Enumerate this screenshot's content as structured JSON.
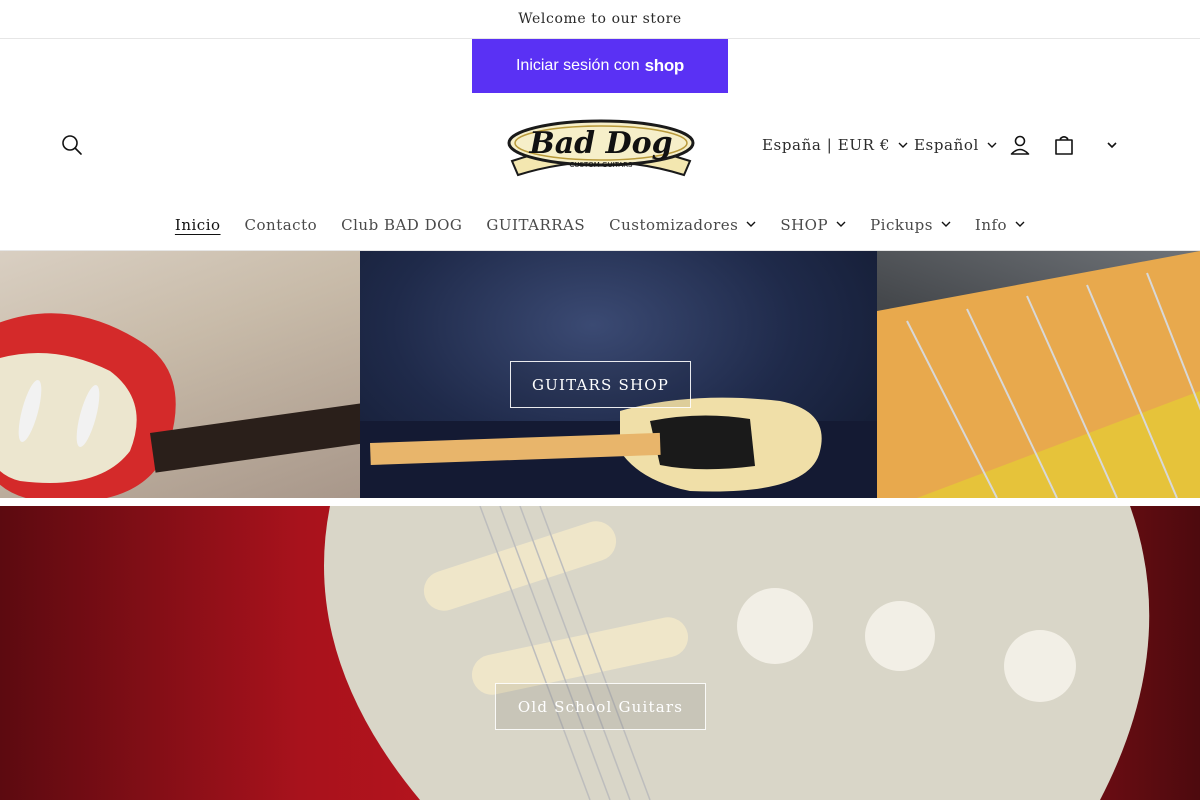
{
  "announcement": {
    "text": "Welcome to our store"
  },
  "shop_login": {
    "label": "Iniciar sesión con",
    "brand": "shop",
    "color": "#5a31f4"
  },
  "header": {
    "logo": {
      "line1": "Bad Dog",
      "line2": "CUSTOM GUITARS"
    },
    "country_selector": {
      "value": "España | EUR €"
    },
    "language_selector": {
      "value": "Español"
    },
    "icons": [
      "search-icon",
      "account-icon",
      "cart-icon",
      "chevron-down-icon"
    ]
  },
  "nav": {
    "items": [
      {
        "label": "Inicio",
        "active": true,
        "dropdown": false
      },
      {
        "label": "Contacto",
        "active": false,
        "dropdown": false
      },
      {
        "label": "Club BAD DOG",
        "active": false,
        "dropdown": false
      },
      {
        "label": "GUITARRAS",
        "active": false,
        "dropdown": false
      },
      {
        "label": "Customizadores",
        "active": false,
        "dropdown": true
      },
      {
        "label": "SHOP",
        "active": false,
        "dropdown": true
      },
      {
        "label": "Pickups",
        "active": false,
        "dropdown": true
      },
      {
        "label": "Info",
        "active": false,
        "dropdown": true
      }
    ]
  },
  "collage_banner": {
    "button_label": "GUITARS SHOP"
  },
  "hero_banner": {
    "button_label": "Old School Guitars"
  },
  "colors": {
    "accent_shop": "#5a31f4",
    "guitar_red": "#c3161f"
  }
}
